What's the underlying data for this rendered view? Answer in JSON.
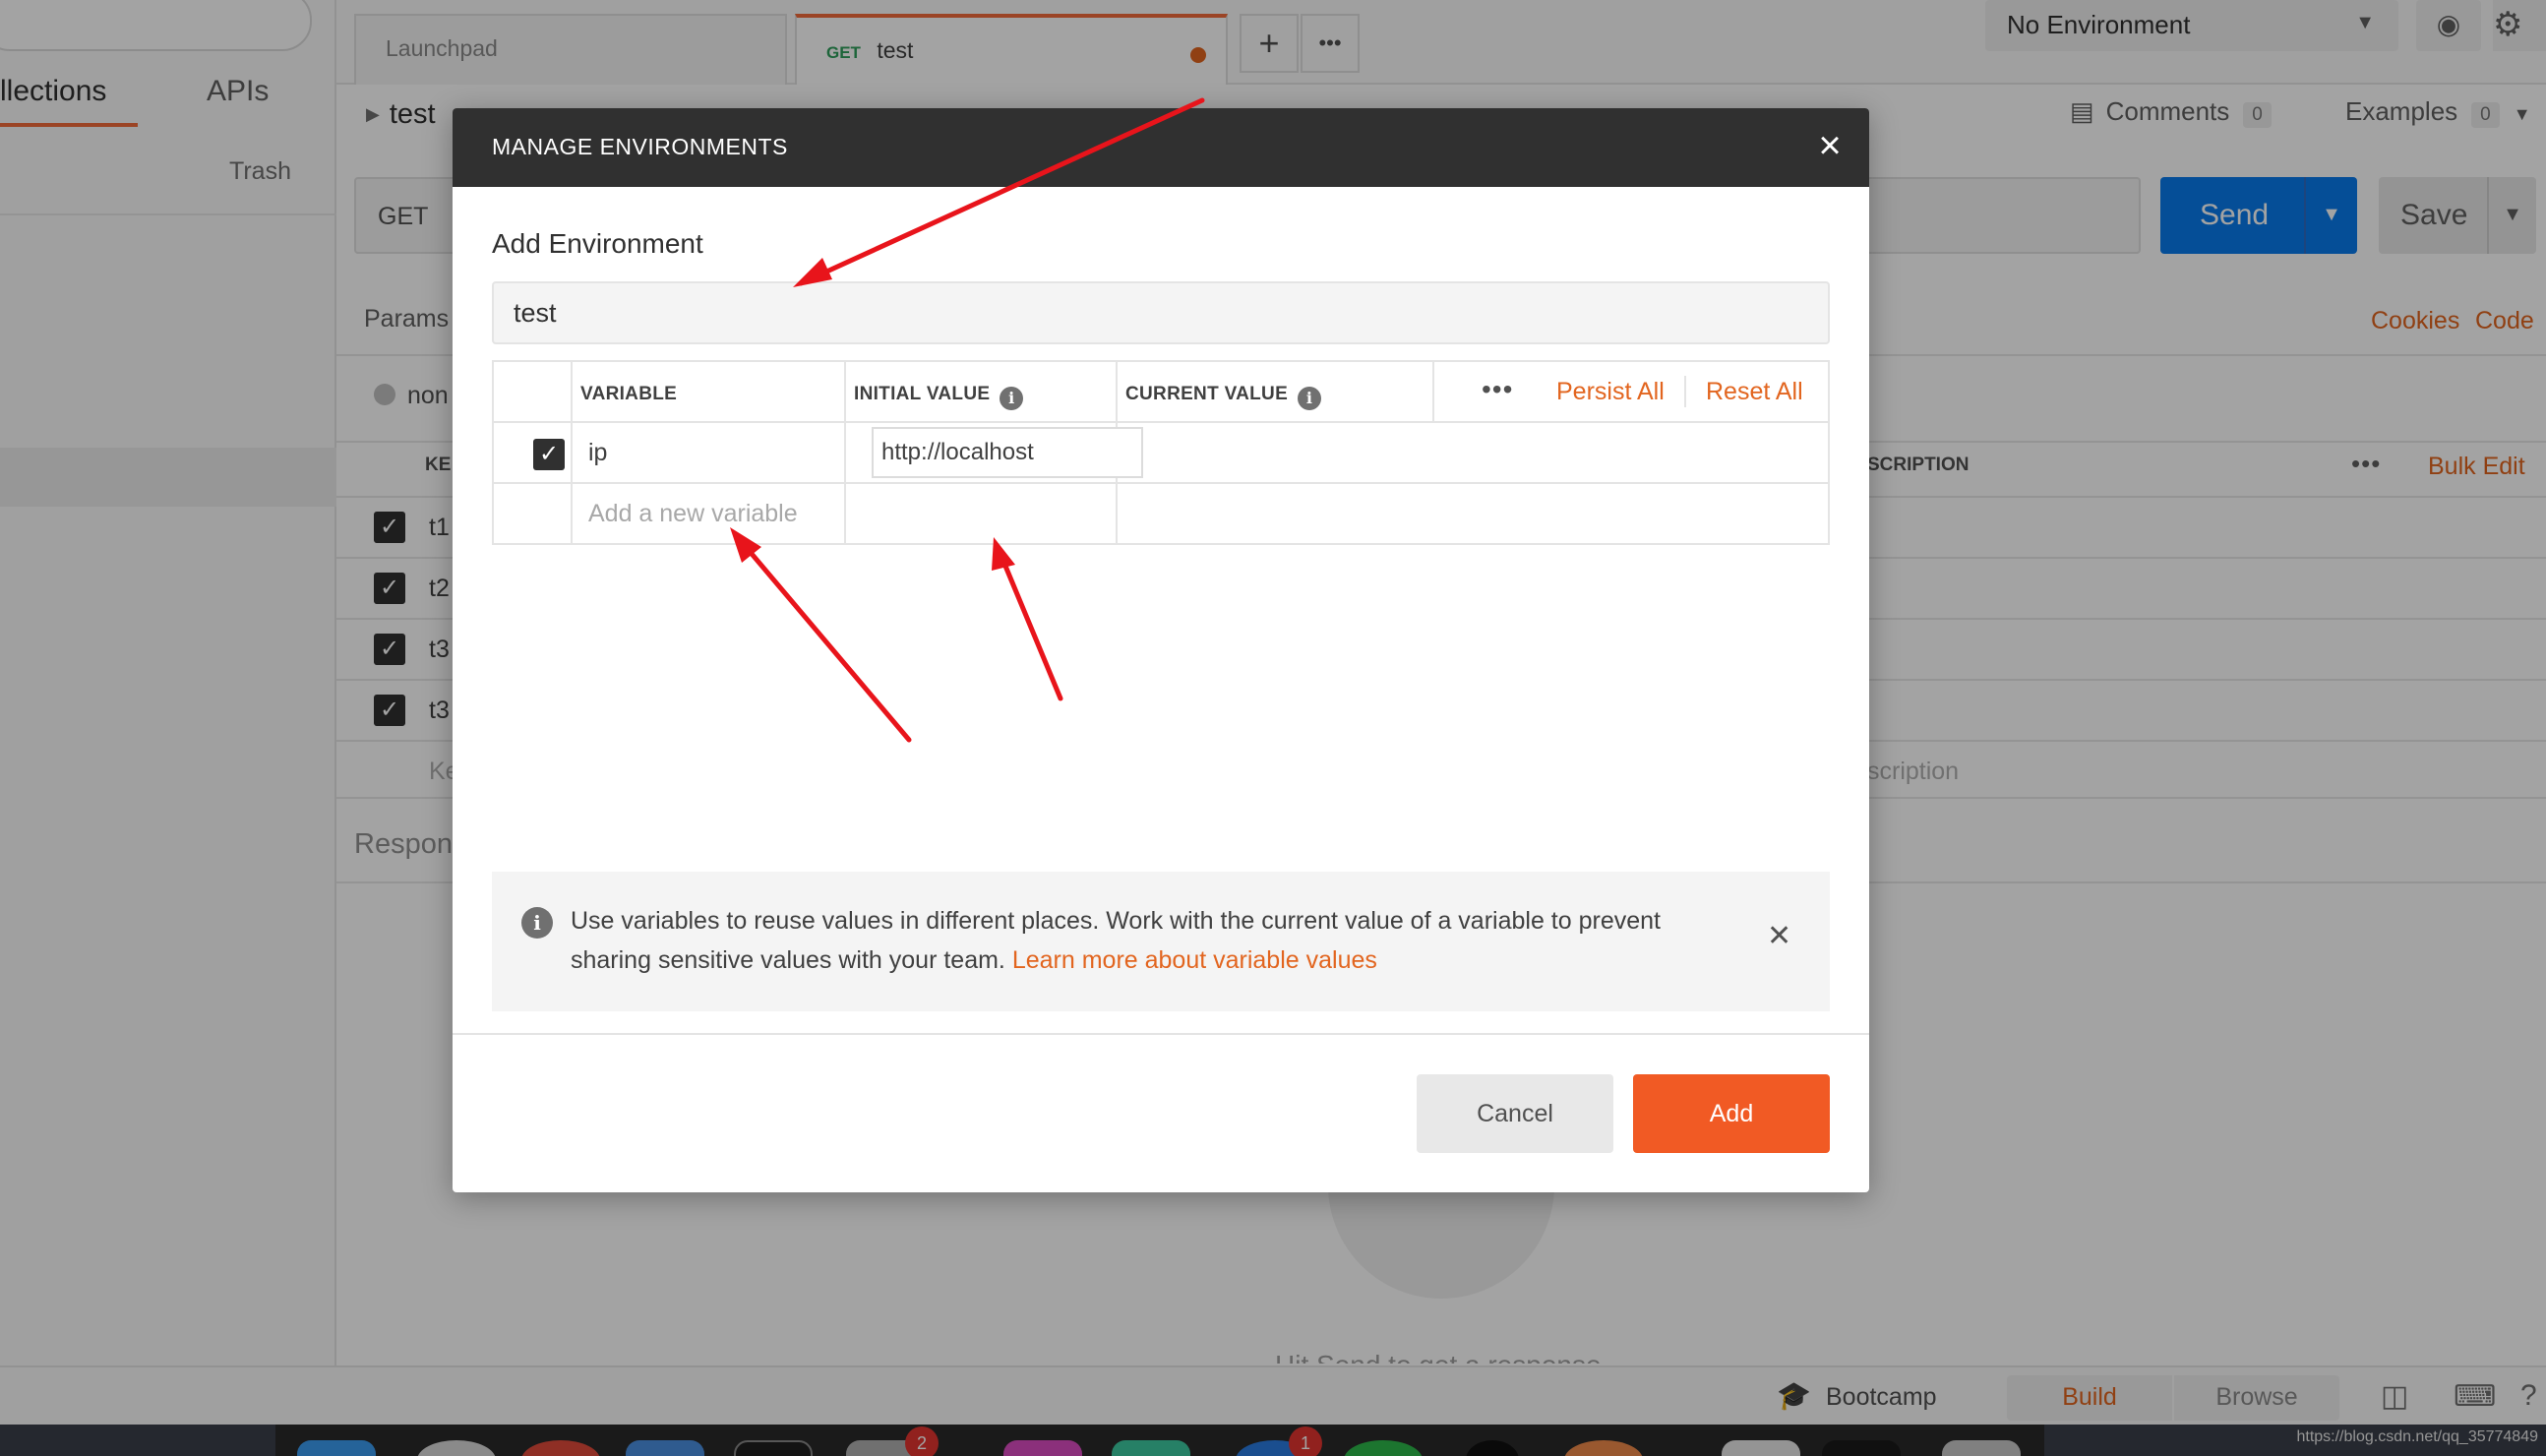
{
  "sidebar": {
    "tabs": [
      "llections",
      "APIs"
    ],
    "trash_label": "Trash"
  },
  "tabs": {
    "launchpad_label": "Launchpad",
    "request_method": "GET",
    "request_label": "test",
    "add_label": "+",
    "more_label": "•••"
  },
  "environment": {
    "selected": "No Environment"
  },
  "request": {
    "breadcrumb": "test",
    "comments_label": "Comments",
    "comments_count": "0",
    "examples_label": "Examples",
    "examples_count": "0",
    "method": "GET",
    "send_label": "Send",
    "save_label": "Save",
    "params_label": "Params",
    "cookies_label": "Cookies",
    "code_label": "Code",
    "body_none_label": "non",
    "key_header": "KE",
    "description_header": "SCRIPTION",
    "bulk_edit_label": "Bulk Edit",
    "rows": [
      "t1",
      "t2",
      "t3",
      "t3"
    ],
    "key_placeholder": "Ke",
    "description_placeholder": "scription",
    "response_label": "Respon",
    "hit_send_label": "Hit Send to get a response"
  },
  "statusbar": {
    "bootcamp_label": "Bootcamp",
    "build_label": "Build",
    "browse_label": "Browse"
  },
  "dock": {
    "badges": [
      "2",
      "1"
    ]
  },
  "watermark": "https://blog.csdn.net/qq_35774849",
  "modal": {
    "title": "MANAGE ENVIRONMENTS",
    "add_env_label": "Add Environment",
    "env_name_value": "test",
    "columns": {
      "variable": "VARIABLE",
      "initial_value": "INITIAL VALUE",
      "current_value": "CURRENT VALUE"
    },
    "more_label": "•••",
    "persist_all_label": "Persist All",
    "reset_all_label": "Reset All",
    "variable_row": {
      "name": "ip",
      "initial_value": "http://localhost",
      "current_value": ""
    },
    "new_variable_placeholder": "Add a new variable",
    "info_text": "Use variables to reuse values in different places. Work with the current value of a variable to prevent sharing sensitive values with your team.",
    "info_link": "Learn more about variable values",
    "cancel_label": "Cancel",
    "add_label": "Add"
  },
  "colors": {
    "accent": "#f15a24",
    "link": "#e2651f",
    "send_blue": "#097bed",
    "annotation_arrow": "#e8141b"
  }
}
